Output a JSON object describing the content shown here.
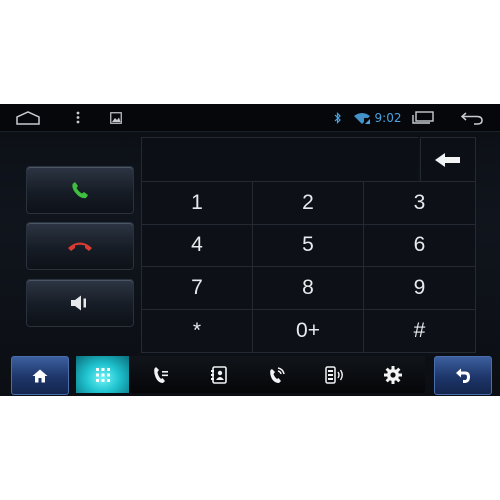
{
  "status_bar": {
    "time": "9:02",
    "icons": [
      "home-outline-icon",
      "overflow-menu-icon",
      "image-icon",
      "bluetooth-icon",
      "wifi-icon",
      "recent-apps-icon",
      "back-arrow-icon"
    ]
  },
  "dialer": {
    "side_buttons": [
      "call-icon",
      "hang-up-icon",
      "volume-icon"
    ],
    "backspace_icon": "backspace-arrow-icon",
    "keys": [
      "1",
      "2",
      "3",
      "4",
      "5",
      "6",
      "7",
      "8",
      "9",
      "*",
      "0+",
      "#"
    ]
  },
  "bottom_bar": {
    "home_icon": "home-icon",
    "return_icon": "return-arrow-icon",
    "tabs": [
      {
        "icon": "keypad-icon",
        "active": true
      },
      {
        "icon": "call-log-icon",
        "active": false
      },
      {
        "icon": "contacts-book-icon",
        "active": false
      },
      {
        "icon": "phone-ringing-icon",
        "active": false
      },
      {
        "icon": "device-sync-icon",
        "active": false
      },
      {
        "icon": "settings-gear-icon",
        "active": false
      }
    ]
  },
  "colors": {
    "accent_blue": "#4aa3df",
    "call_green": "#3fbf3f",
    "hangup_red": "#d93a32",
    "active_tab_cyan": "#2fd3dc"
  }
}
